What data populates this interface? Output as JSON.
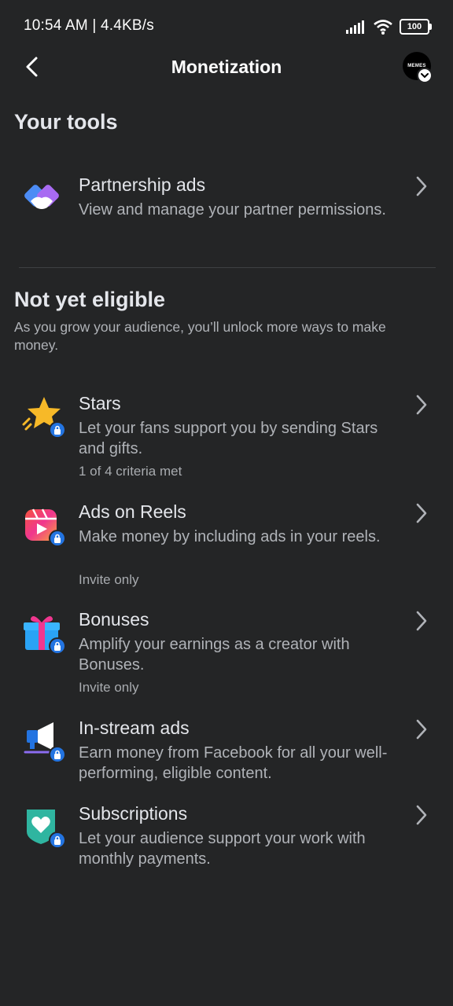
{
  "status_bar": {
    "time_speed": "10:54 AM | 4.4KB/s",
    "battery": "100"
  },
  "header": {
    "title": "Monetization",
    "avatar_text": "MEMES"
  },
  "your_tools": {
    "title": "Your tools",
    "items": [
      {
        "title": "Partnership ads",
        "description": "View and manage your partner permissions."
      }
    ]
  },
  "not_eligible": {
    "title": "Not yet eligible",
    "description": "As you grow your audience, you’ll unlock more ways to make money.",
    "items": [
      {
        "title": "Stars",
        "description": "Let your fans support you by sending Stars and gifts.",
        "meta": "1 of 4 criteria met",
        "icon": "star-icon"
      },
      {
        "title": "Ads on Reels",
        "description": "Make money by including ads in your reels.",
        "meta": "Invite only",
        "icon": "reels-icon"
      },
      {
        "title": "Bonuses",
        "description": "Amplify your earnings as a creator with Bonuses.",
        "meta": "Invite only",
        "icon": "gift-icon"
      },
      {
        "title": "In-stream ads",
        "description": "Earn money from Facebook for all your well-performing, eligible content.",
        "icon": "megaphone-icon"
      },
      {
        "title": "Subscriptions",
        "description": "Let your audience support your work with monthly payments.",
        "icon": "heart-shield-icon"
      }
    ]
  },
  "colors": {
    "background": "#242526",
    "accent": "#2374e1",
    "text": "#e4e6eb",
    "secondary_text": "#b0b3b8"
  }
}
